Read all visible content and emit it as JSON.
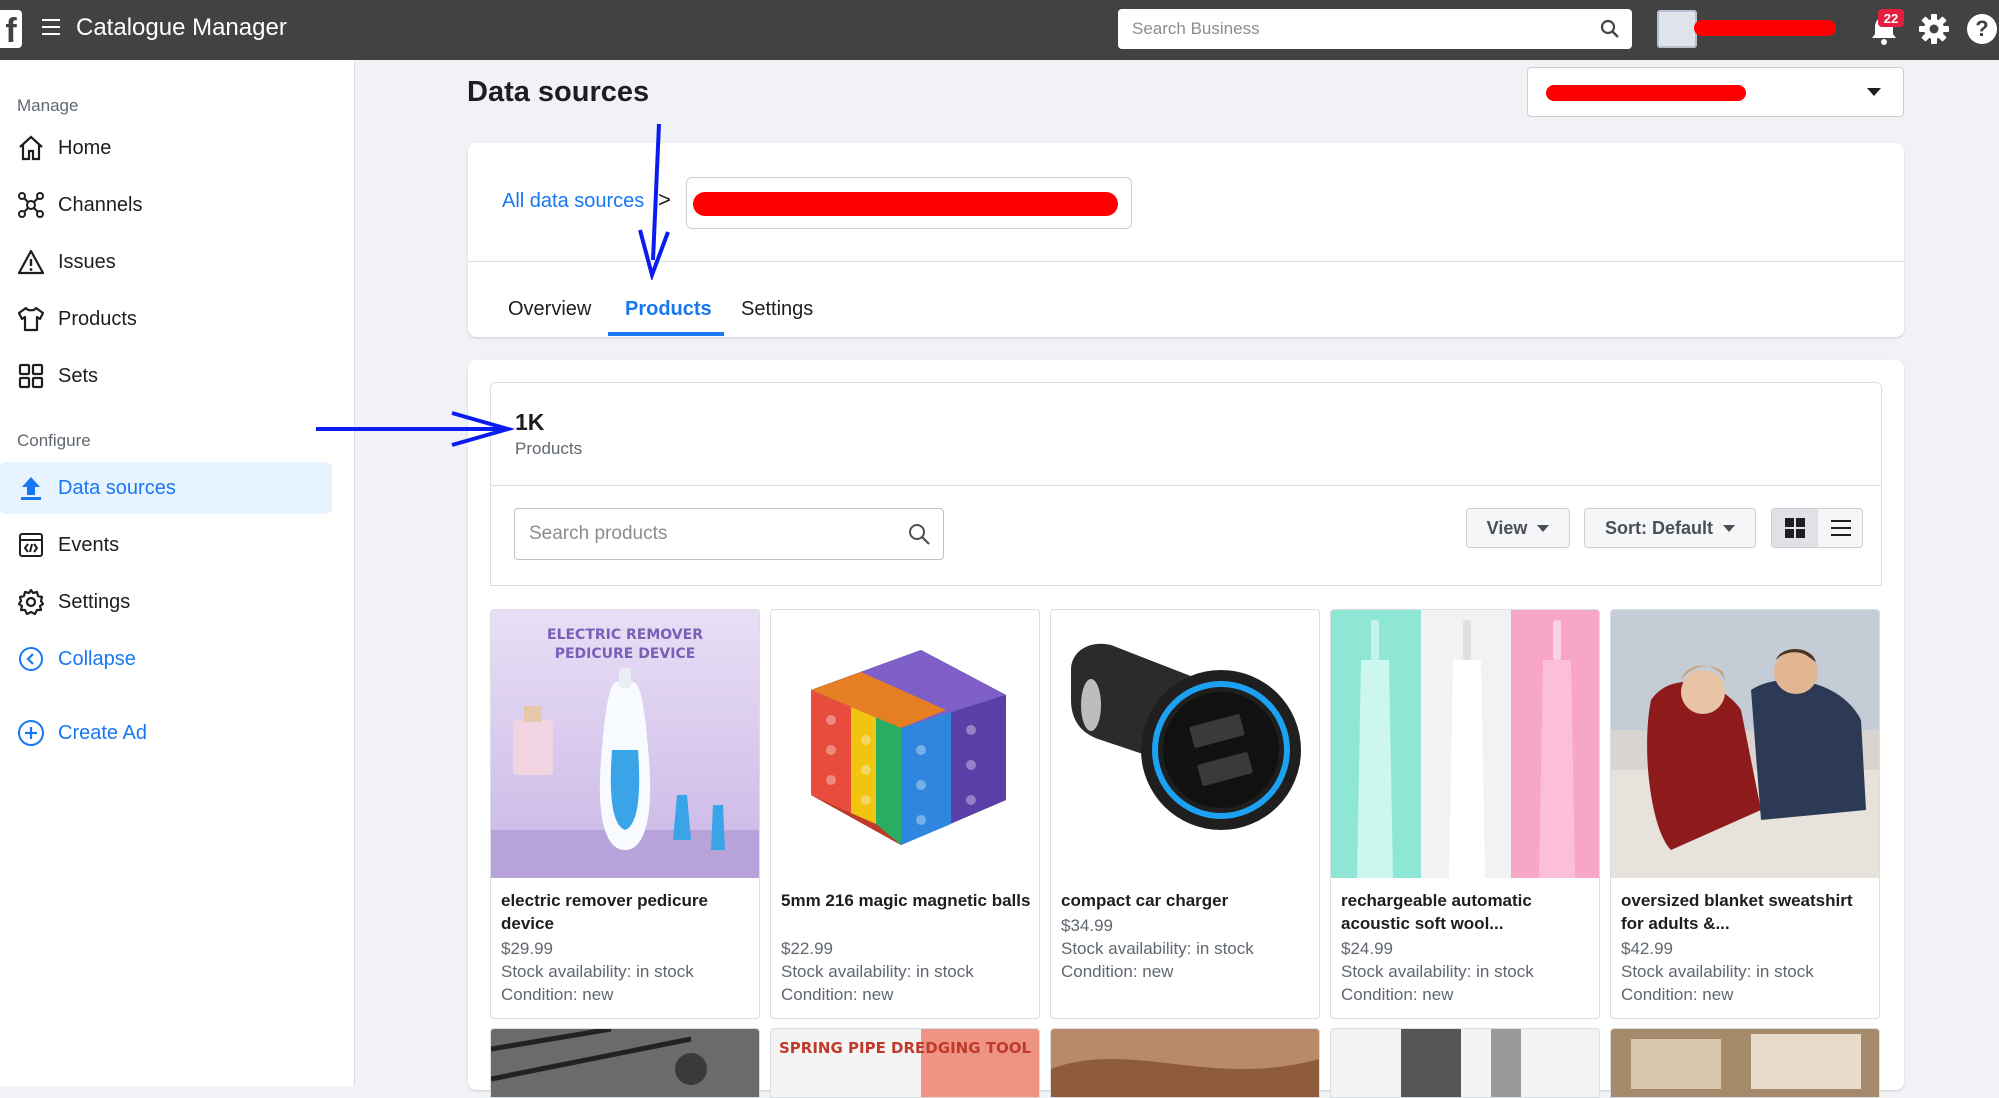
{
  "topbar": {
    "logo": "f",
    "title": "Catalogue Manager",
    "search_placeholder": "Search Business",
    "notification_count": "22",
    "help": "?"
  },
  "sidebar": {
    "manage_label": "Manage",
    "manage_items": [
      {
        "label": "Home",
        "icon": "home-icon"
      },
      {
        "label": "Channels",
        "icon": "channels-icon"
      },
      {
        "label": "Issues",
        "icon": "warning-icon"
      },
      {
        "label": "Products",
        "icon": "shirt-icon"
      },
      {
        "label": "Sets",
        "icon": "grid-icon"
      }
    ],
    "configure_label": "Configure",
    "configure_items": [
      {
        "label": "Data sources",
        "icon": "upload-icon",
        "active": true
      },
      {
        "label": "Events",
        "icon": "code-window-icon"
      },
      {
        "label": "Settings",
        "icon": "gear-icon"
      }
    ],
    "collapse_label": "Collapse",
    "create_ad_label": "Create Ad"
  },
  "main": {
    "page_title": "Data sources",
    "breadcrumb_link": "All data sources",
    "breadcrumb_separator": ">",
    "tabs": [
      {
        "label": "Overview",
        "active": false
      },
      {
        "label": "Products",
        "active": true
      },
      {
        "label": "Settings",
        "active": false
      }
    ],
    "product_count": "1K",
    "product_count_label": "Products",
    "search_placeholder": "Search products",
    "view_label": "View",
    "sort_label": "Sort: Default",
    "products": [
      {
        "name": "electric remover pedicure device",
        "price": "$29.99",
        "availability": "Stock availability: in stock",
        "condition": "Condition: new",
        "image_text_1": "ELECTRIC REMOVER",
        "image_text_2": "PEDICURE DEVICE"
      },
      {
        "name": "5mm 216 magic magnetic balls",
        "price": "$22.99",
        "availability": "Stock availability: in stock",
        "condition": "Condition: new"
      },
      {
        "name": "compact car charger",
        "price": "$34.99",
        "availability": "Stock availability: in stock",
        "condition": "Condition: new"
      },
      {
        "name": "rechargeable automatic acoustic soft wool...",
        "price": "$24.99",
        "availability": "Stock availability: in stock",
        "condition": "Condition: new"
      },
      {
        "name": "oversized blanket sweatshirt for adults &...",
        "price": "$42.99",
        "availability": "Stock availability: in stock",
        "condition": "Condition: new"
      }
    ],
    "second_row_text": "SPRING PIPE DREDGING TOOL"
  },
  "colors": {
    "accent": "#1877f2",
    "topbar": "#424242",
    "annotation_arrow": "#0a1cf0",
    "redaction": "#ff0000"
  }
}
